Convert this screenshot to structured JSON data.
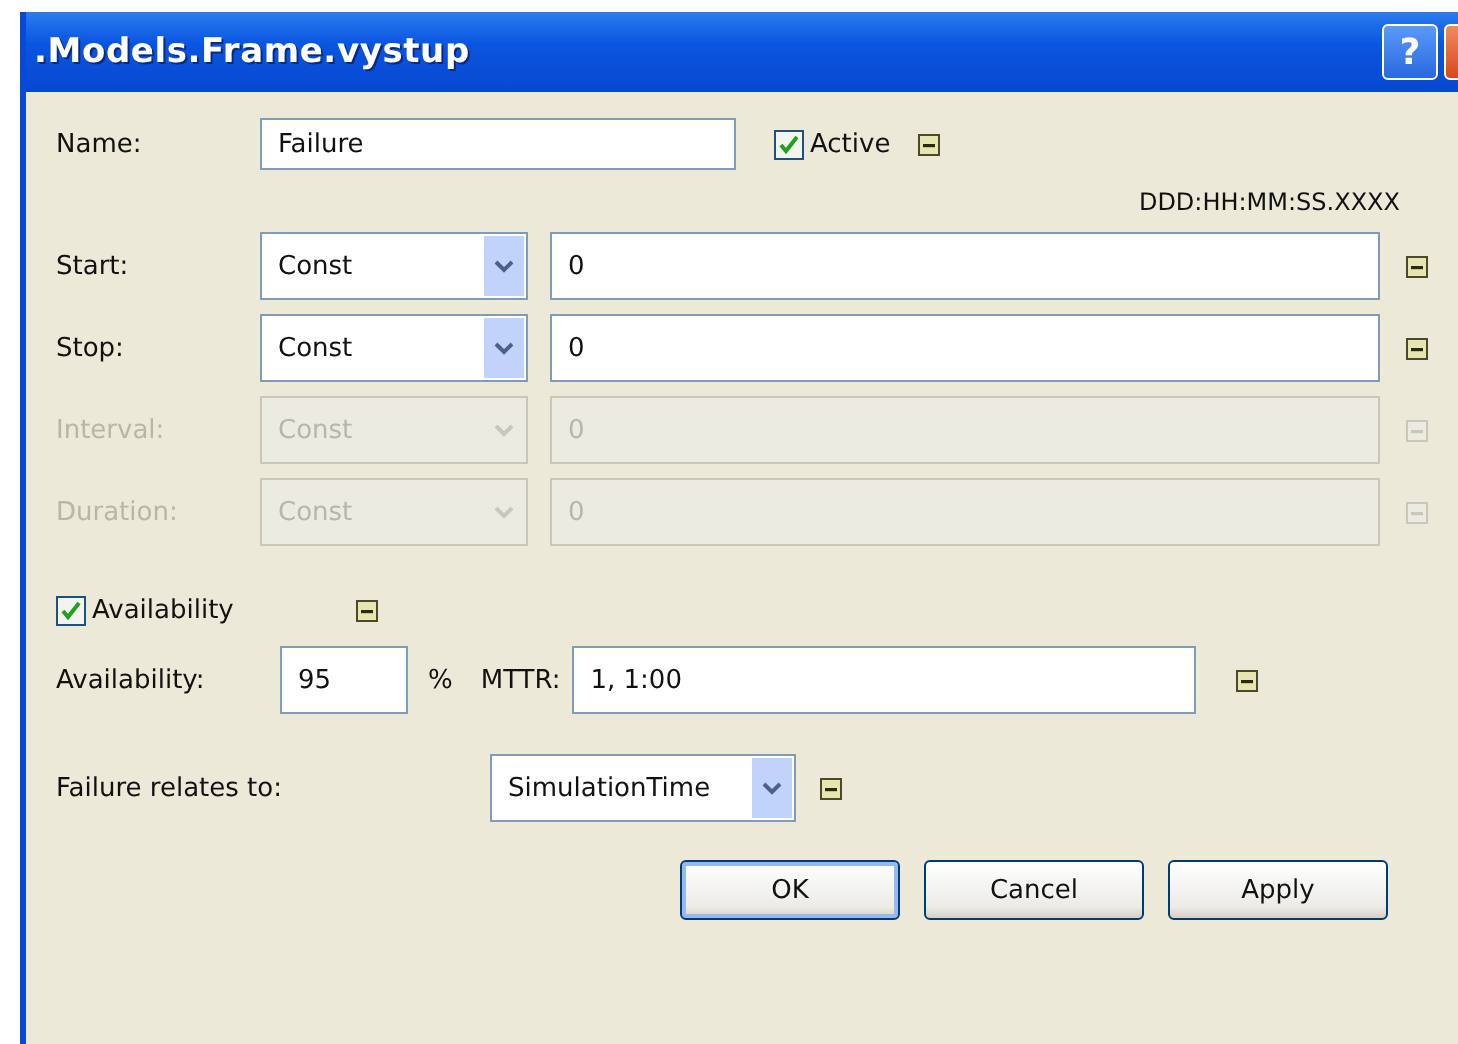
{
  "window": {
    "title": ".Models.Frame.vystup",
    "help_glyph": "?"
  },
  "name": {
    "label": "Name:",
    "value": "Failure"
  },
  "active": {
    "label": "Active",
    "checked": true
  },
  "format_hint": "DDD:HH:MM:SS.XXXX",
  "timing": [
    {
      "label": "Start:",
      "mode": "Const",
      "value": "0",
      "disabled": false
    },
    {
      "label": "Stop:",
      "mode": "Const",
      "value": "0",
      "disabled": false
    },
    {
      "label": "Interval:",
      "mode": "Const",
      "value": "0",
      "disabled": true
    },
    {
      "label": "Duration:",
      "mode": "Const",
      "value": "0",
      "disabled": true
    }
  ],
  "availability_toggle": {
    "label": "Availability",
    "checked": true
  },
  "availability": {
    "label": "Availability:",
    "value": "95",
    "unit": "%"
  },
  "mttr": {
    "label": "MTTR:",
    "value": "1, 1:00"
  },
  "failure_relates": {
    "label": "Failure relates to:",
    "value": "SimulationTime"
  },
  "buttons": [
    {
      "label": "OK",
      "default": true
    },
    {
      "label": "Cancel",
      "default": false
    },
    {
      "label": "Apply",
      "default": false
    }
  ]
}
